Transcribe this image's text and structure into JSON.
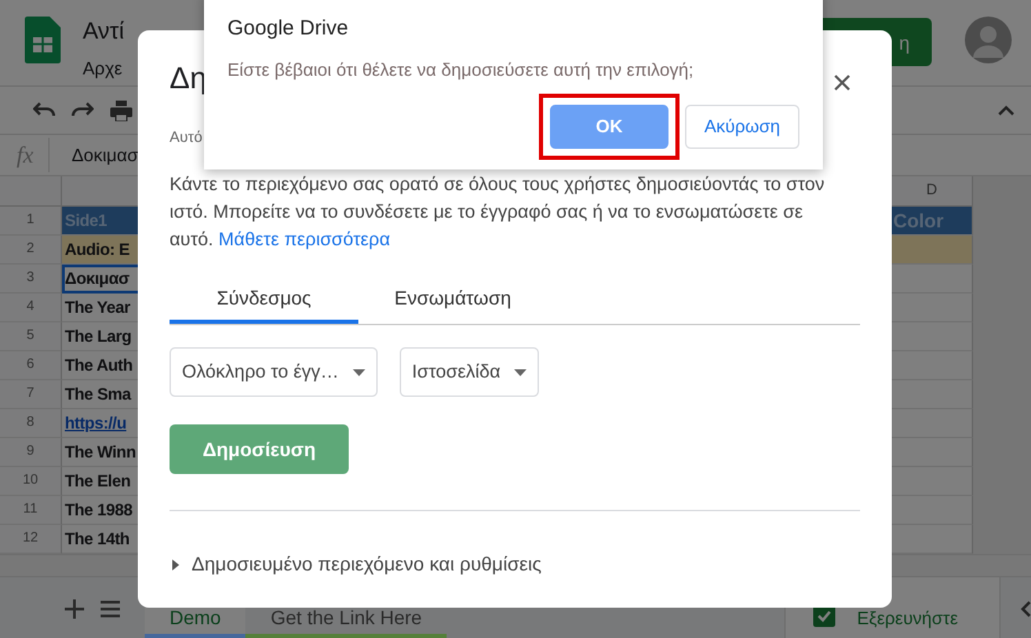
{
  "app": {
    "title": "Αντί",
    "menu": [
      "Αρχε"
    ],
    "share_button": "η"
  },
  "formula_bar": {
    "fx": "fx",
    "value": "Δοκιμασ"
  },
  "sheet": {
    "column_d": "D",
    "rows": [
      {
        "number": "1",
        "kind": "header",
        "cell_a": "Side1",
        "cell_d": "Color",
        "selected": false
      },
      {
        "number": "2",
        "kind": "note",
        "cell_a": "Audio: E",
        "selected": false
      },
      {
        "number": "3",
        "kind": "text",
        "cell_a": "Δοκιμασ",
        "selected": true
      },
      {
        "number": "4",
        "kind": "text",
        "cell_a": "The Year",
        "selected": false
      },
      {
        "number": "5",
        "kind": "text",
        "cell_a": "The Larg",
        "selected": false
      },
      {
        "number": "6",
        "kind": "text",
        "cell_a": "The Auth",
        "selected": false
      },
      {
        "number": "7",
        "kind": "text",
        "cell_a": "The Sma",
        "selected": false
      },
      {
        "number": "8",
        "kind": "link",
        "cell_a": "https://u",
        "selected": false
      },
      {
        "number": "9",
        "kind": "text",
        "cell_a": "The Winn",
        "selected": false
      },
      {
        "number": "10",
        "kind": "text",
        "cell_a": "The Elen",
        "selected": false
      },
      {
        "number": "11",
        "kind": "text",
        "cell_a": "The 1988",
        "selected": false
      },
      {
        "number": "12",
        "kind": "text",
        "cell_a": "The 14th",
        "selected": false
      }
    ]
  },
  "sheet_tabs": [
    {
      "label": "Demo",
      "selected": true,
      "color": "#46689c"
    },
    {
      "label": "Get the Link Here",
      "selected": false,
      "color": "#55803a"
    }
  ],
  "explore_button": "Εξερευνήστε",
  "publish_dialog": {
    "title": "Δη",
    "note": "Αυτό",
    "description": "Κάντε το περιεχόμενο σας ορατό σε όλους τους χρήστες δημοσιεύοντάς το στον ιστό. Μπορείτε να το συνδέσετε με το έγγραφό σας ή να το ενσωματώσετε σε αυτό.",
    "link": "Μάθετε περισσότερα",
    "tabs": [
      {
        "label": "Σύνδεσμος",
        "selected": true
      },
      {
        "label": "Ενσωμάτωση",
        "selected": false
      }
    ],
    "dropdowns": [
      "Ολόκληρο το έγγ…",
      "Ιστοσελίδα"
    ],
    "publish_button": "Δημοσίευση",
    "published_section": {
      "label": "Δημοσιευμένο περιεχόμενο και ρυθμίσεις",
      "expanded": false
    }
  },
  "confirm_dialog": {
    "title": "Google Drive",
    "message": "Είστε βέβαιοι ότι θέλετε να δημοσιεύσετε αυτή την επιλογή;",
    "buttons": [
      {
        "label": "OK",
        "kind": "primary",
        "highlighted": true
      },
      {
        "label": "Ακύρωση",
        "kind": "secondary",
        "highlighted": false
      }
    ]
  }
}
